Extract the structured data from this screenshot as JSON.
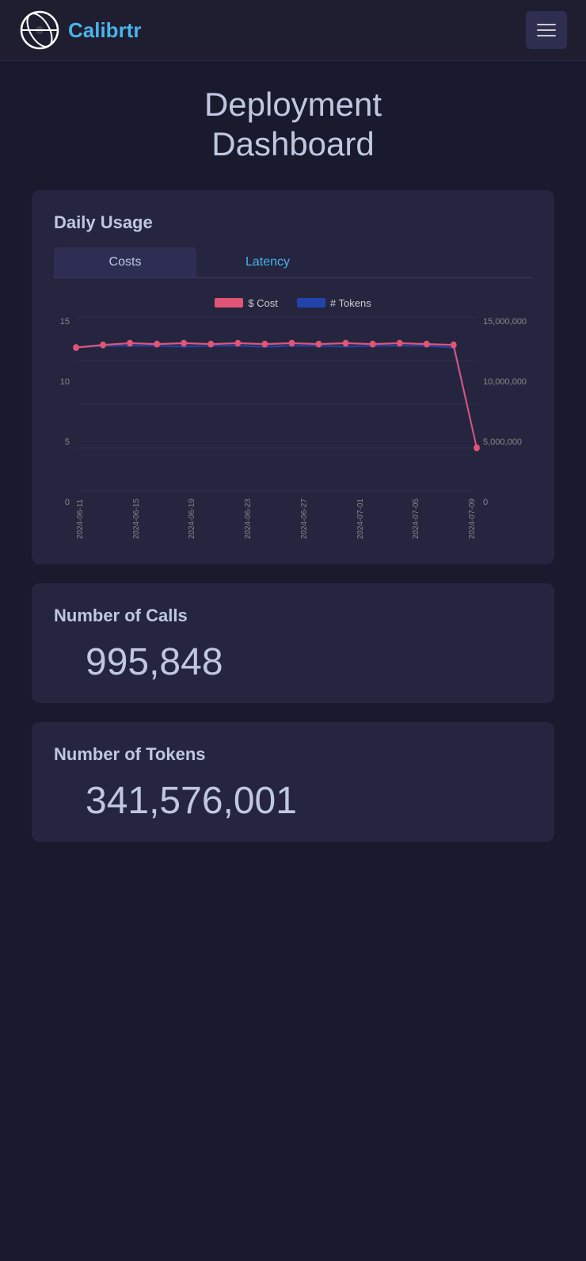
{
  "nav": {
    "logo_text": "Calibrtr",
    "hamburger_label": "Toggle navigation"
  },
  "page": {
    "title_line1": "Deployment",
    "title_line2": "Dashboard"
  },
  "daily_usage": {
    "title": "Daily Usage",
    "tab_costs": "Costs",
    "tab_latency": "Latency",
    "legend": {
      "cost_label": "$ Cost",
      "tokens_label": "# Tokens"
    },
    "y_left": [
      "15",
      "10",
      "5",
      "0"
    ],
    "y_right": [
      "15,000,000",
      "10,000,000",
      "5,000,000",
      "0"
    ],
    "x_labels": [
      "2024-06-11",
      "2024-06-15",
      "2024-06-19",
      "2024-06-23",
      "2024-06-27",
      "2024-07-01",
      "2024-07-05",
      "2024-07-09"
    ],
    "cost_color": "#e05575",
    "tokens_color": "#2244aa"
  },
  "calls_card": {
    "title": "Number of Calls",
    "value": "995,848"
  },
  "tokens_card": {
    "title": "Number of Tokens",
    "value": "341,576,001"
  }
}
